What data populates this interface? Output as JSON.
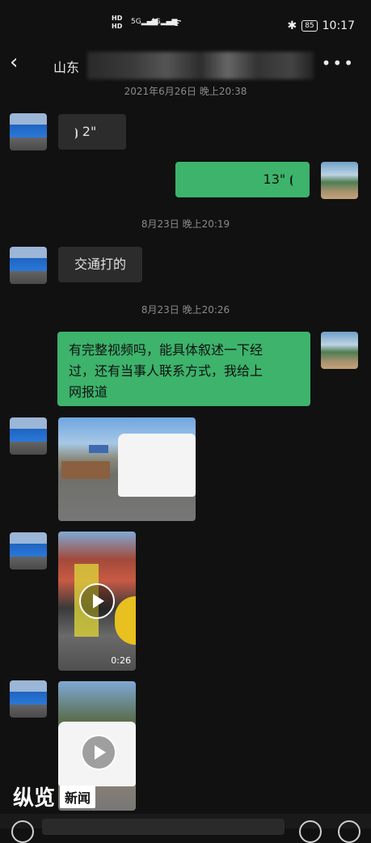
{
  "status_bar": {
    "hd1": "HD",
    "hd2": "HD",
    "sig1": "5G",
    "sig2": "4G",
    "battery": "85",
    "time": "10:17"
  },
  "header": {
    "back_icon": "chevron-left-icon",
    "title": "山东",
    "more_icon": "more-icon"
  },
  "messages": {
    "ts1": "2021年6月26日 晚上20:38",
    "voice_other_duration": "2\"",
    "voice_self_duration": "13\"",
    "ts2": "8月23日 晚上20:19",
    "text_other_1": "交通打的",
    "ts3": "8月23日 晚上20:26",
    "text_self_1_line1": "有完整视频吗，能具体叙述一下经",
    "text_self_1_line2": "过，还有当事人联系方式，我给上",
    "text_self_1_line3": "网报道",
    "video1_duration": "0:26"
  },
  "watermark": {
    "logo": "纵览",
    "news": "新闻"
  },
  "colors": {
    "background": "#111111",
    "bubble_self": "#3db36b",
    "bubble_other": "#2c2c2c"
  }
}
